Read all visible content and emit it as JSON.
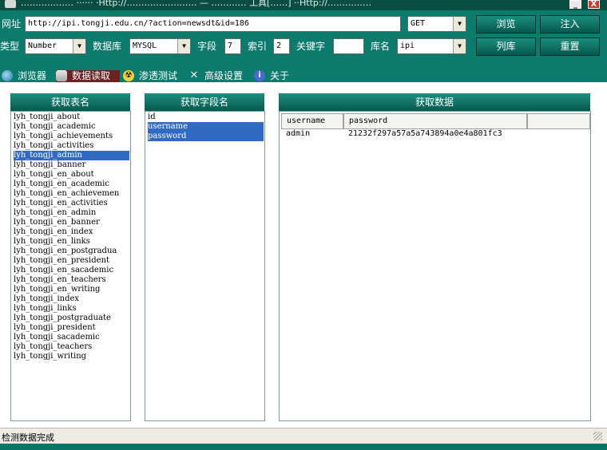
{
  "window": {
    "title": "……………… ······  ·Http://…………………… — ………… 工具[……] ··Http://……………",
    "minimize": "_",
    "close": "X"
  },
  "toolbar": {
    "url_label": "网址",
    "url_value": "http://ipi.tongji.edu.cn/?action=newsdt&id=186",
    "method_value": "GET",
    "type_label": "类型",
    "type_value": "Number",
    "db_label": "数据库",
    "db_value": "MYSQL",
    "field_label": "字段",
    "field_value": "7",
    "index_label": "索引",
    "index_value": "2",
    "keyword_label": "关键字",
    "keyword_value": "",
    "dbname_label": "库名",
    "dbname_value": "ipi",
    "browse_label": "浏览",
    "inject_label": "注入",
    "listdb_label": "列库",
    "reset_label": "重置"
  },
  "tabs": [
    {
      "label": "浏览器",
      "icon": "globe-icon"
    },
    {
      "label": "数据读取",
      "icon": "database-icon",
      "active": true
    },
    {
      "label": "渗透测试",
      "icon": "radiation-icon"
    },
    {
      "label": "高级设置",
      "icon": "tools-icon"
    },
    {
      "label": "关于",
      "icon": "info-icon"
    }
  ],
  "tables_panel": {
    "header": "获取表名",
    "selected": "lyh_tongji_admin",
    "items": [
      "lyh_tongji_about",
      "lyh_tongji_academic",
      "lyh_tongji_achievements",
      "lyh_tongji_activities",
      "lyh_tongji_admin",
      "lyh_tongji_banner",
      "lyh_tongji_en_about",
      "lyh_tongji_en_academic",
      "lyh_tongji_en_achievemen",
      "lyh_tongji_en_activities",
      "lyh_tongji_en_admin",
      "lyh_tongji_en_banner",
      "lyh_tongji_en_index",
      "lyh_tongji_en_links",
      "lyh_tongji_en_postgradua",
      "lyh_tongji_en_president",
      "lyh_tongji_en_sacademic",
      "lyh_tongji_en_teachers",
      "lyh_tongji_en_writing",
      "lyh_tongji_index",
      "lyh_tongji_links",
      "lyh_tongji_postgraduate",
      "lyh_tongji_president",
      "lyh_tongji_sacademic",
      "lyh_tongji_teachers",
      "lyh_tongji_writing"
    ]
  },
  "fields_panel": {
    "header": "获取字段名",
    "items": [
      "id",
      "username",
      "password"
    ],
    "selected": [
      "username",
      "password"
    ]
  },
  "data_panel": {
    "header": "获取数据",
    "columns": [
      "username",
      "password"
    ],
    "rows": [
      [
        "admin",
        "21232f297a57a5a743894a0e4a801fc3"
      ]
    ]
  },
  "status": {
    "text": "检测数据完成"
  }
}
